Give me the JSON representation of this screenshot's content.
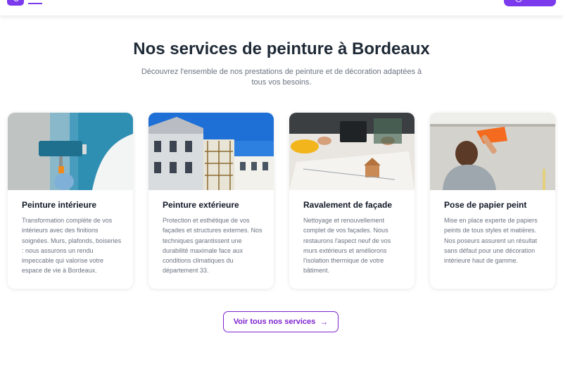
{
  "section": {
    "title": "Nos services de peinture à Bordeaux",
    "subtitle": "Découvrez l'ensemble de nos prestations de peinture et de décoration adaptées à tous vos besoins."
  },
  "services": [
    {
      "title": "Peinture intérieure",
      "description": "Transformation complète de vos intérieurs avec des finitions soignées. Murs, plafonds, boiseries : nous assurons un rendu impeccable qui valorise votre espace de vie à Bordeaux."
    },
    {
      "title": "Peinture extérieure",
      "description": "Protection et esthétique de vos façades et structures externes. Nos techniques garantissent une durabilité maximale face aux conditions climatiques du département 33."
    },
    {
      "title": "Ravalement de façade",
      "description": "Nettoyage et renouvellement complet de vos façades. Nous restaurons l'aspect neuf de vos murs extérieurs et améliorons l'isolation thermique de votre bâtiment."
    },
    {
      "title": "Pose de papier peint",
      "description": "Mise en place experte de papiers peints de tous styles et matières. Nos poseurs assurent un résultat sans défaut pour une décoration intérieure haut de gamme."
    }
  ],
  "cta": {
    "label": "Voir tous nos services",
    "icon": "arrow-right-icon"
  },
  "colors": {
    "accent": "#7c3aed",
    "button_border": "#7e22ce",
    "title": "#1f2a37",
    "body_text": "#6b7280"
  }
}
